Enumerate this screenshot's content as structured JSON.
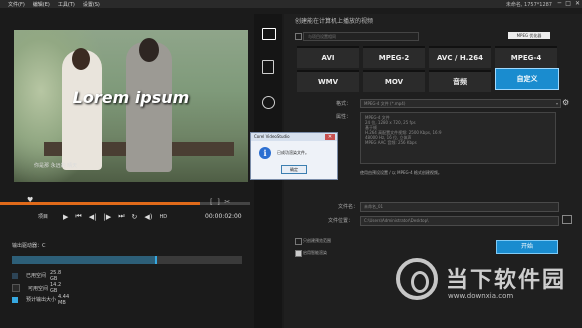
{
  "menu": {
    "items": [
      "文件(F)",
      "编辑(E)",
      "工具(T)",
      "设置(S)"
    ],
    "title": "未命名, 1757*1287"
  },
  "window_controls": {
    "minimize": "─",
    "maximize": "□",
    "close": "✕"
  },
  "preview": {
    "caption": "Lorem ipsum",
    "signature": "你是那 永远的 晴天"
  },
  "transport": {
    "project_label": "项目",
    "timecode": "00:00:02:00",
    "hd": "HD"
  },
  "output": {
    "drive_label": "输出驱动器：C",
    "used_fraction": 0.62,
    "legend": [
      {
        "label": "已用空间",
        "value": "25.8 GB",
        "color": "#2d4456"
      },
      {
        "label": "可用空间",
        "value": "14.2 GB",
        "color": "#2a2a2a"
      },
      {
        "label": "预计输出大小",
        "value": "4.44 MB",
        "color": "#36a8e0"
      }
    ]
  },
  "right": {
    "header": "创建能在计算机上播放的视频",
    "preset_label": "与项目设置相同",
    "mode_button": "MPEG 优化器",
    "formats": [
      "AVI",
      "MPEG-2",
      "AVC / H.264",
      "MPEG-4",
      "WMV",
      "MOV",
      "音频",
      "自定义"
    ],
    "format_field_label": "格式：",
    "format_value": "MPEG-4 文件 (*.mp4)",
    "props_label": "属性：",
    "props_lines": [
      "MPEG-4 文件",
      "24 位, 1280 x 720, 25 fps",
      "基于帧",
      "H.264 高配置文件视频: 2500 Kbps, 16:9",
      "48000 Hz, 16 位, 立体声",
      "MPEG AAC 音频: 256 Kbps"
    ],
    "checkbox_text": "使用由预设设置 / 以 MPEG-4 格式创建视频。",
    "filename_label": "文件名：",
    "filename_value": "未命名_01",
    "location_label": "文件位置：",
    "location_value": "C:\\Users\\Administrator\\Desktop\\",
    "opt1": "只创建预览范围",
    "opt2": "启用智能渲染",
    "start_button": "开始"
  },
  "dialog": {
    "title": "Corel VideoStudio",
    "message": "已成功渲染文件。",
    "ok": "确定"
  },
  "watermark": {
    "name": "当下软件园",
    "url": "www.downxia.com"
  }
}
